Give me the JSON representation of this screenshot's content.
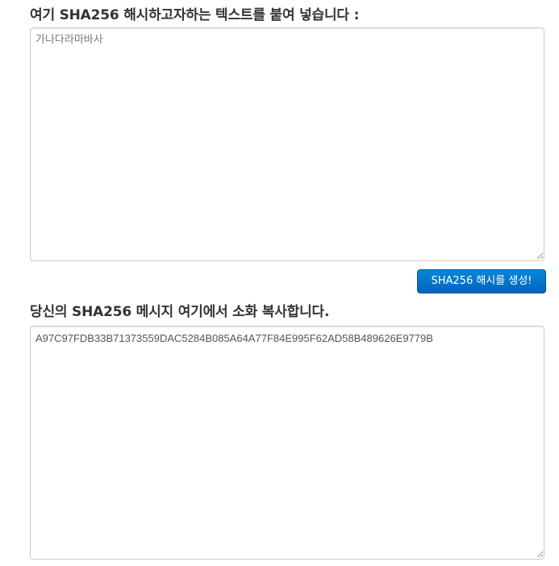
{
  "input_section": {
    "label": "여기 SHA256 해시하고자하는 텍스트를 붙여 넣습니다 :",
    "placeholder": "가나다라마바사",
    "value": ""
  },
  "generate_button": {
    "label": "SHA256 해시를 생성!"
  },
  "output_section": {
    "label": "당신의 SHA256 메시지 여기에서 소화 복사합니다.",
    "value": "A97C97FDB33B71373559DAC5284B085A64A77F84E995F62AD58B489626E9779B"
  },
  "colors": {
    "button_top": "#0a86d8",
    "button_bottom": "#0064bf",
    "border": "#cccccc",
    "label_text": "#333333"
  },
  "icons": {
    "resize_grip": "resize-grip-icon"
  }
}
